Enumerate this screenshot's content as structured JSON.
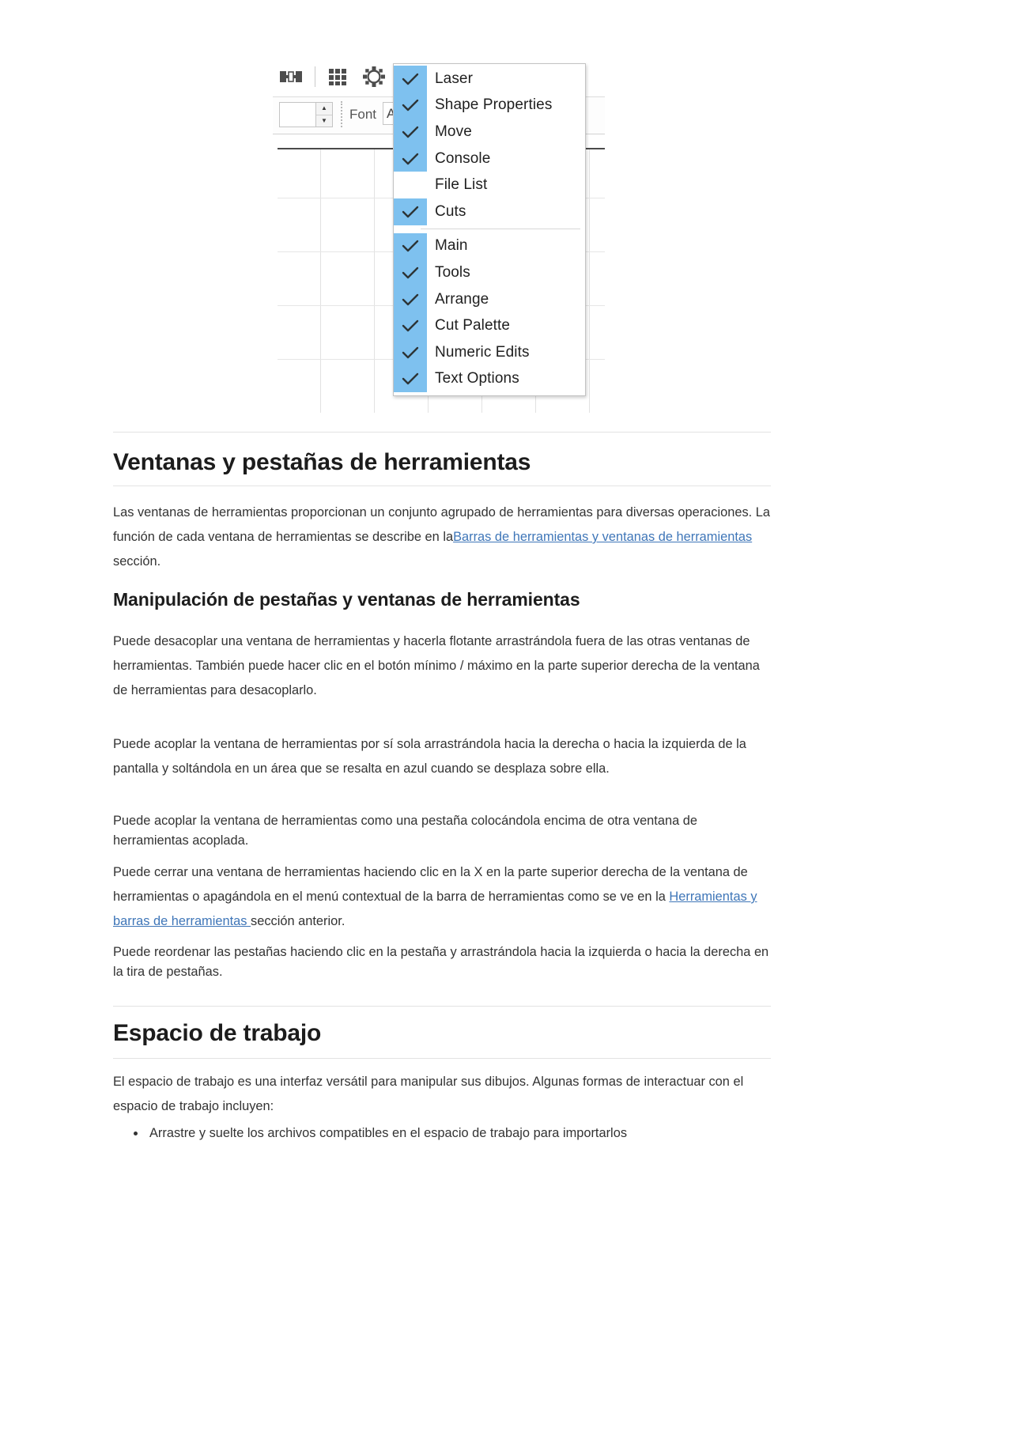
{
  "figure": {
    "toolbar": {
      "icons": [
        "dock-panel-icon",
        "grid-icon",
        "gear-nodes-icon"
      ],
      "spinner_value": "",
      "font_label": "Font",
      "font_value": "Ar"
    },
    "context_menu": {
      "groups": [
        {
          "items": [
            {
              "label": "Laser",
              "checked": true
            },
            {
              "label": "Shape Properties",
              "checked": true
            },
            {
              "label": "Move",
              "checked": true
            },
            {
              "label": "Console",
              "checked": true
            },
            {
              "label": "File List",
              "checked": false
            },
            {
              "label": "Cuts",
              "checked": true
            }
          ]
        },
        {
          "items": [
            {
              "label": "Main",
              "checked": true
            },
            {
              "label": "Tools",
              "checked": true
            },
            {
              "label": "Arrange",
              "checked": true
            },
            {
              "label": "Cut Palette",
              "checked": true
            },
            {
              "label": "Numeric Edits",
              "checked": true
            },
            {
              "label": "Text Options",
              "checked": true
            }
          ]
        }
      ]
    }
  },
  "doc": {
    "section1": {
      "heading": "Ventanas y pestañas de herramientas",
      "para1_before": "Las ventanas de herramientas proporcionan un conjunto agrupado de herramientas para diversas operaciones. La función de cada ventana de herramientas se describe en la",
      "para1_link": "Barras de herramientas y ventanas de herramientas ",
      "para1_after": "sección.",
      "subheading": "Manipulación de pestañas y ventanas de herramientas",
      "para2": "Puede desacoplar una ventana de herramientas y hacerla flotante arrastrándola fuera de las otras ventanas de herramientas. También puede hacer clic en el botón mínimo / máximo en la parte superior derecha de la ventana de herramientas para desacoplarlo.",
      "para3": "Puede acoplar la ventana de herramientas por sí sola arrastrándola hacia la derecha o hacia la izquierda de la pantalla y soltándola en un área que se resalta en azul cuando se desplaza sobre ella.",
      "para4": "Puede acoplar la ventana de herramientas como una pestaña colocándola encima de otra ventana de herramientas acoplada.",
      "para5_before": "Puede cerrar una ventana de herramientas haciendo clic en la X en la parte superior derecha de la ventana de herramientas o apagándola en el menú contextual de la barra de herramientas como se ve en la ",
      "para5_link": "Herramientas y barras de herramientas ",
      "para5_after": "sección anterior.",
      "para6": "Puede reordenar las pestañas haciendo clic en la pestaña y arrastrándola hacia la izquierda o hacia la derecha en la tira de pestañas."
    },
    "section2": {
      "heading": "Espacio de trabajo",
      "para1": "El espacio de trabajo es una interfaz versátil para manipular sus dibujos. Algunas formas de interactuar con el espacio de trabajo incluyen:",
      "bullets": [
        "Arrastre y suelte los archivos compatibles en el espacio de trabajo para importarlos"
      ]
    }
  },
  "colors": {
    "link": "#3f76b8",
    "menu_check_highlight": "#7ec1ef",
    "rule": "#e3e3e3"
  }
}
